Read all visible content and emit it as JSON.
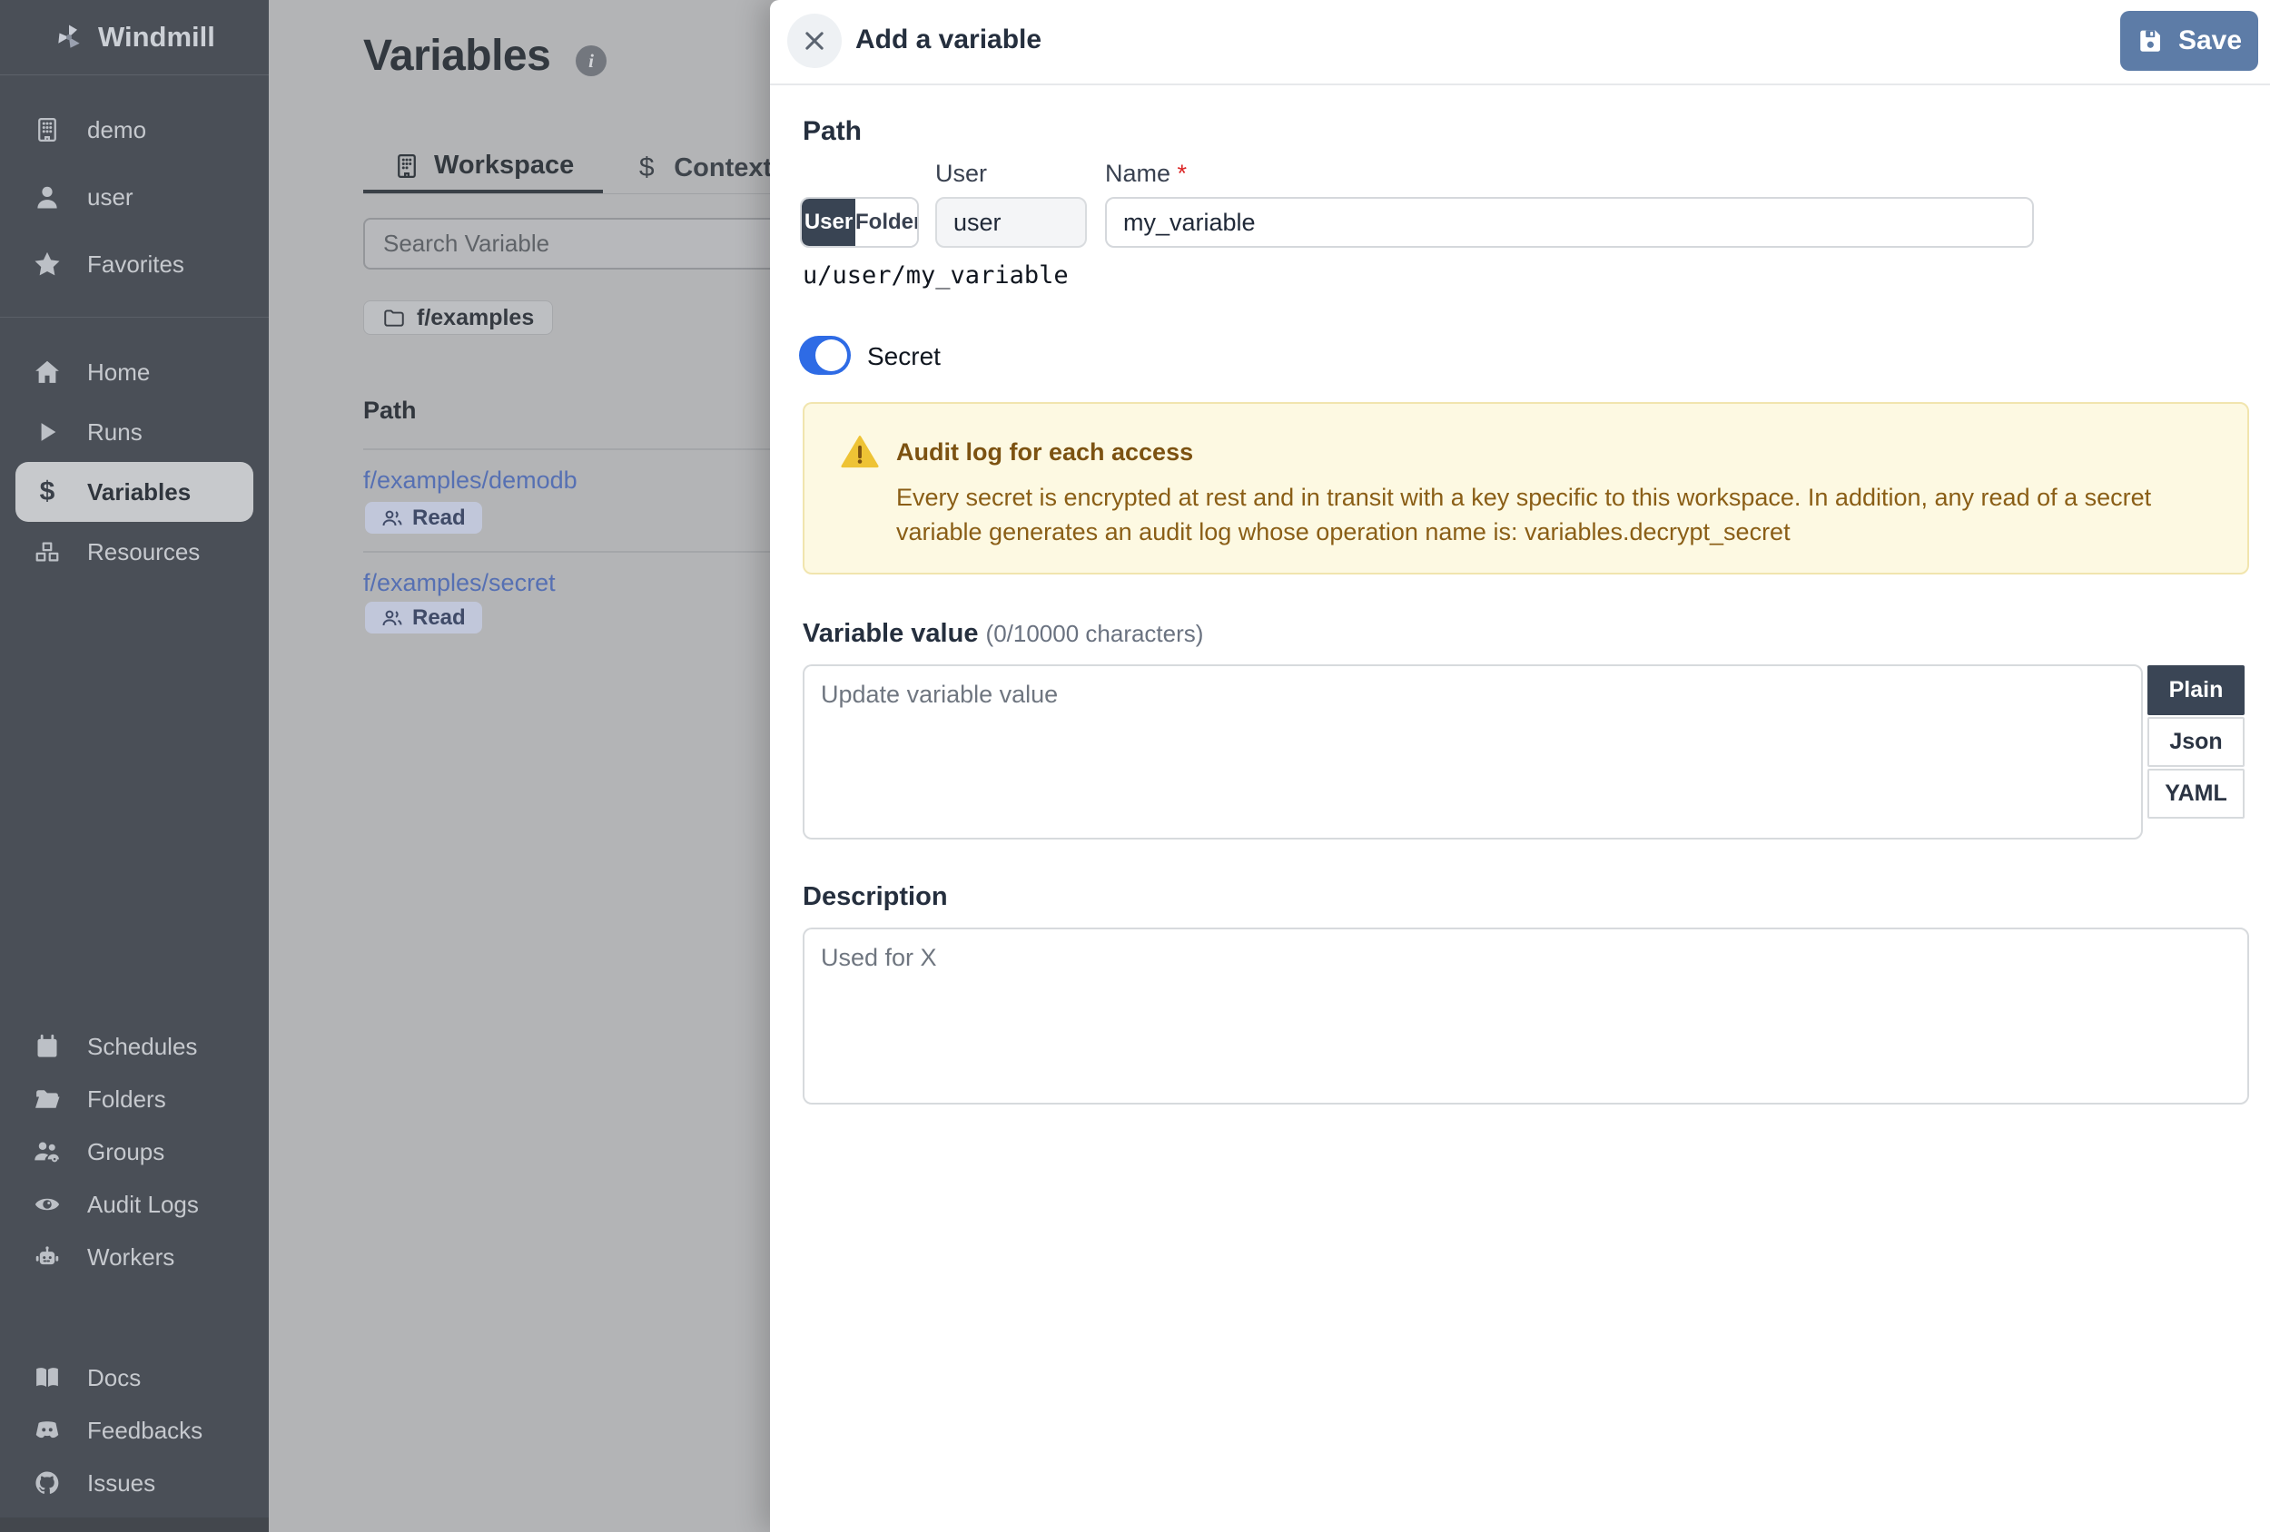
{
  "colors": {
    "sidebar_bg": "#4a4f57",
    "dim_overlay_bg": "#b3b4b6",
    "save_button_blue": "#5d7ca7",
    "secret_toggle_blue": "#2e6be5",
    "link_blue": "#5670b3",
    "badge_bg": "#c1c7da",
    "warning_bg": "#fdf9e2",
    "warning_border": "#f1e5ae",
    "warning_text": "#8a5e16",
    "selected_segment_bg": "#394453",
    "required_red": "#dc2626"
  },
  "sidebar": {
    "logo": "Windmill",
    "top": [
      "demo",
      "user",
      "Favorites"
    ],
    "nav": [
      "Home",
      "Runs",
      "Variables",
      "Resources"
    ],
    "admin": [
      "Schedules",
      "Folders",
      "Groups",
      "Audit Logs",
      "Workers"
    ],
    "footer": [
      "Docs",
      "Feedbacks",
      "Issues"
    ]
  },
  "main": {
    "title": "Variables",
    "tabs": [
      "Workspace",
      "Context"
    ],
    "search_placeholder": "Search Variable",
    "folder_chip": "f/examples",
    "path_header": "Path",
    "rows": [
      {
        "path": "f/examples/demodb",
        "badge": "Read"
      },
      {
        "path": "f/examples/secret",
        "badge": "Read"
      }
    ]
  },
  "drawer": {
    "title": "Add a variable",
    "save_label": "Save",
    "path": {
      "heading": "Path",
      "owner_options": [
        "User",
        "Folder"
      ],
      "selected_owner": "User",
      "user_label": "User",
      "user_value": "user",
      "name_label": "Name",
      "required_mark": "*",
      "name_value": "my_variable",
      "full_path": "u/user/my_variable"
    },
    "secret_label": "Secret",
    "warning": {
      "title": "Audit log for each access",
      "body": "Every secret is encrypted at rest and in transit with a key specific to this workspace. In addition, any read of a secret variable generates an audit log whose operation name is: variables.decrypt_secret"
    },
    "value": {
      "heading": "Variable value",
      "counter": "(0/10000 characters)",
      "placeholder": "Update variable value",
      "formats": [
        "Plain",
        "Json",
        "YAML"
      ],
      "selected_format": "Plain"
    },
    "description": {
      "heading": "Description",
      "placeholder": "Used for X"
    }
  }
}
